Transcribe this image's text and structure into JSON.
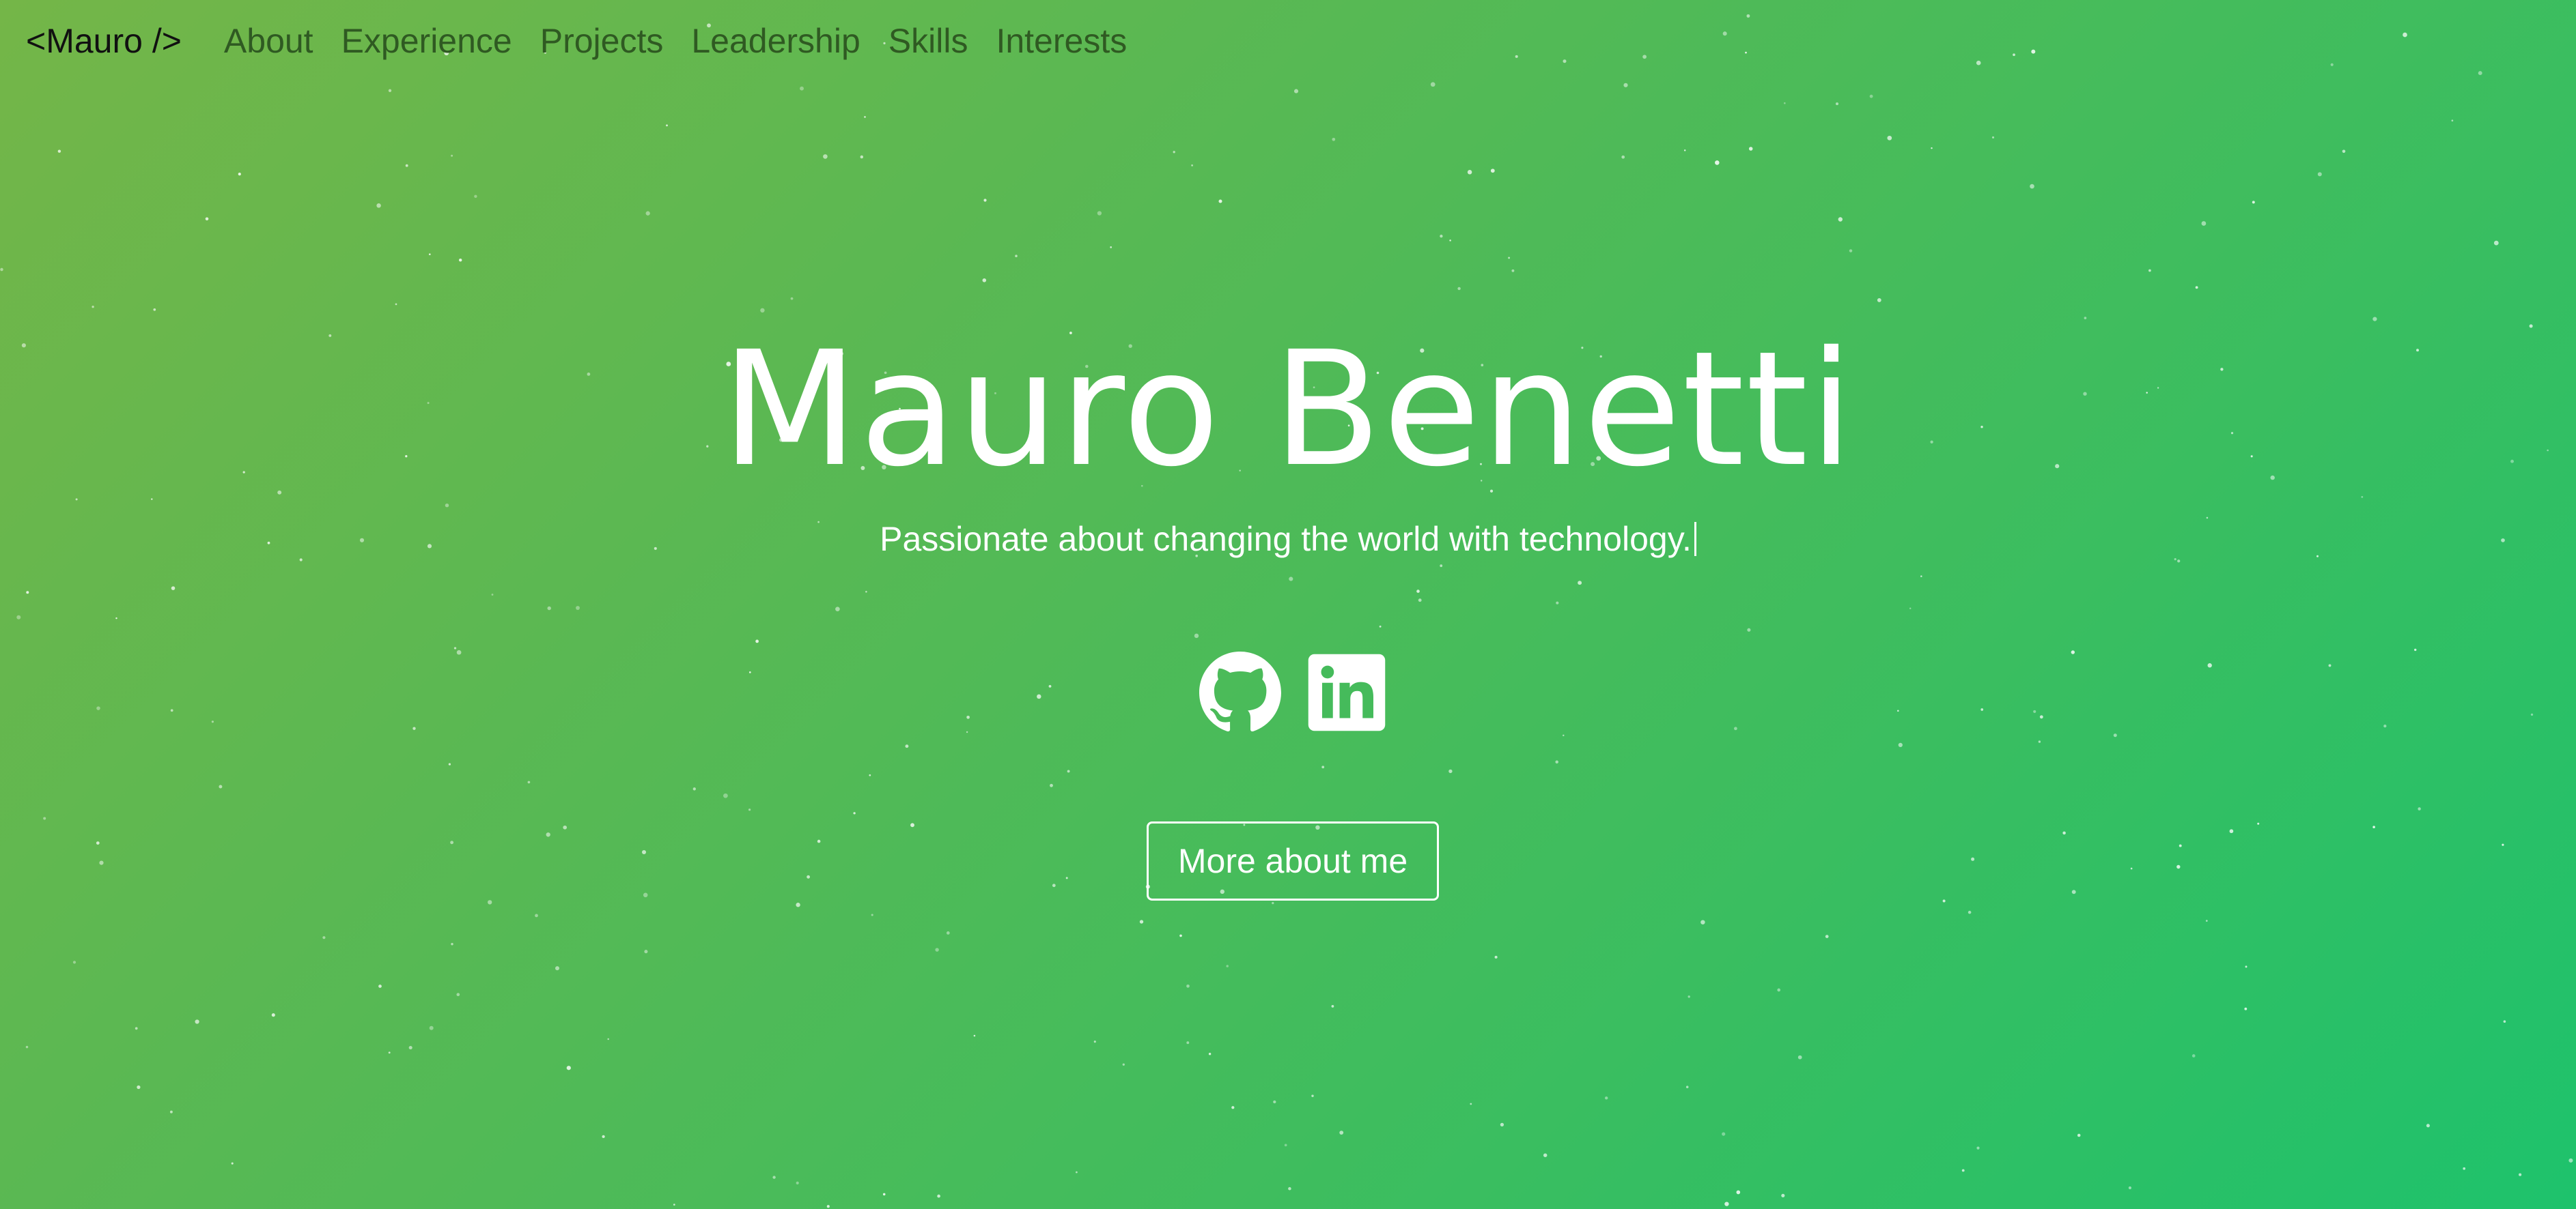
{
  "nav": {
    "brand": "<Mauro />",
    "links": [
      "About",
      "Experience",
      "Projects",
      "Leadership",
      "Skills",
      "Interests"
    ]
  },
  "hero": {
    "title": "Mauro Benetti",
    "subtitle": "Passionate about changing the world with technology.",
    "social": {
      "github_icon": "github-icon",
      "linkedin_icon": "linkedin-icon"
    },
    "cta_label": "More about me"
  },
  "colors": {
    "gradient_start": "#74b648",
    "gradient_end": "#1ec26c",
    "text": "#ffffff",
    "brand_text": "#111111",
    "nav_link": "#2f5a22"
  }
}
